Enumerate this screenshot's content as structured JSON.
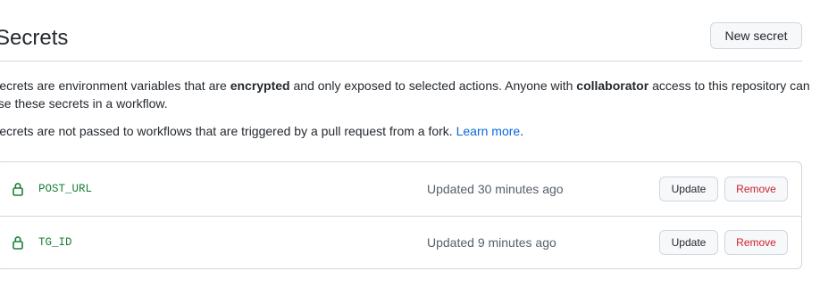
{
  "header": {
    "title": "Secrets",
    "new_secret_label": "New secret"
  },
  "description": {
    "line1_pre": "Secrets are environment variables that are ",
    "line1_bold1": "encrypted",
    "line1_mid": " and only exposed to selected actions. Anyone with ",
    "line1_bold2": "collaborator",
    "line1_post": " access to this repository can",
    "line2": "use these secrets in a workflow.",
    "line3_pre": "Secrets are not passed to workflows that are triggered by a pull request from a fork. ",
    "learn_more": "Learn more",
    "line3_post": "."
  },
  "secrets": [
    {
      "name": "POST_URL",
      "updated": "Updated 30 minutes ago",
      "update_label": "Update",
      "remove_label": "Remove",
      "icon": "lock-icon"
    },
    {
      "name": "TG_ID",
      "updated": "Updated 9 minutes ago",
      "update_label": "Update",
      "remove_label": "Remove",
      "icon": "lock-icon"
    }
  ],
  "colors": {
    "secret_name": "#1a7f37",
    "link": "#0969da",
    "danger": "#cf222e",
    "border": "#d0d7de",
    "muted": "#57606a"
  }
}
